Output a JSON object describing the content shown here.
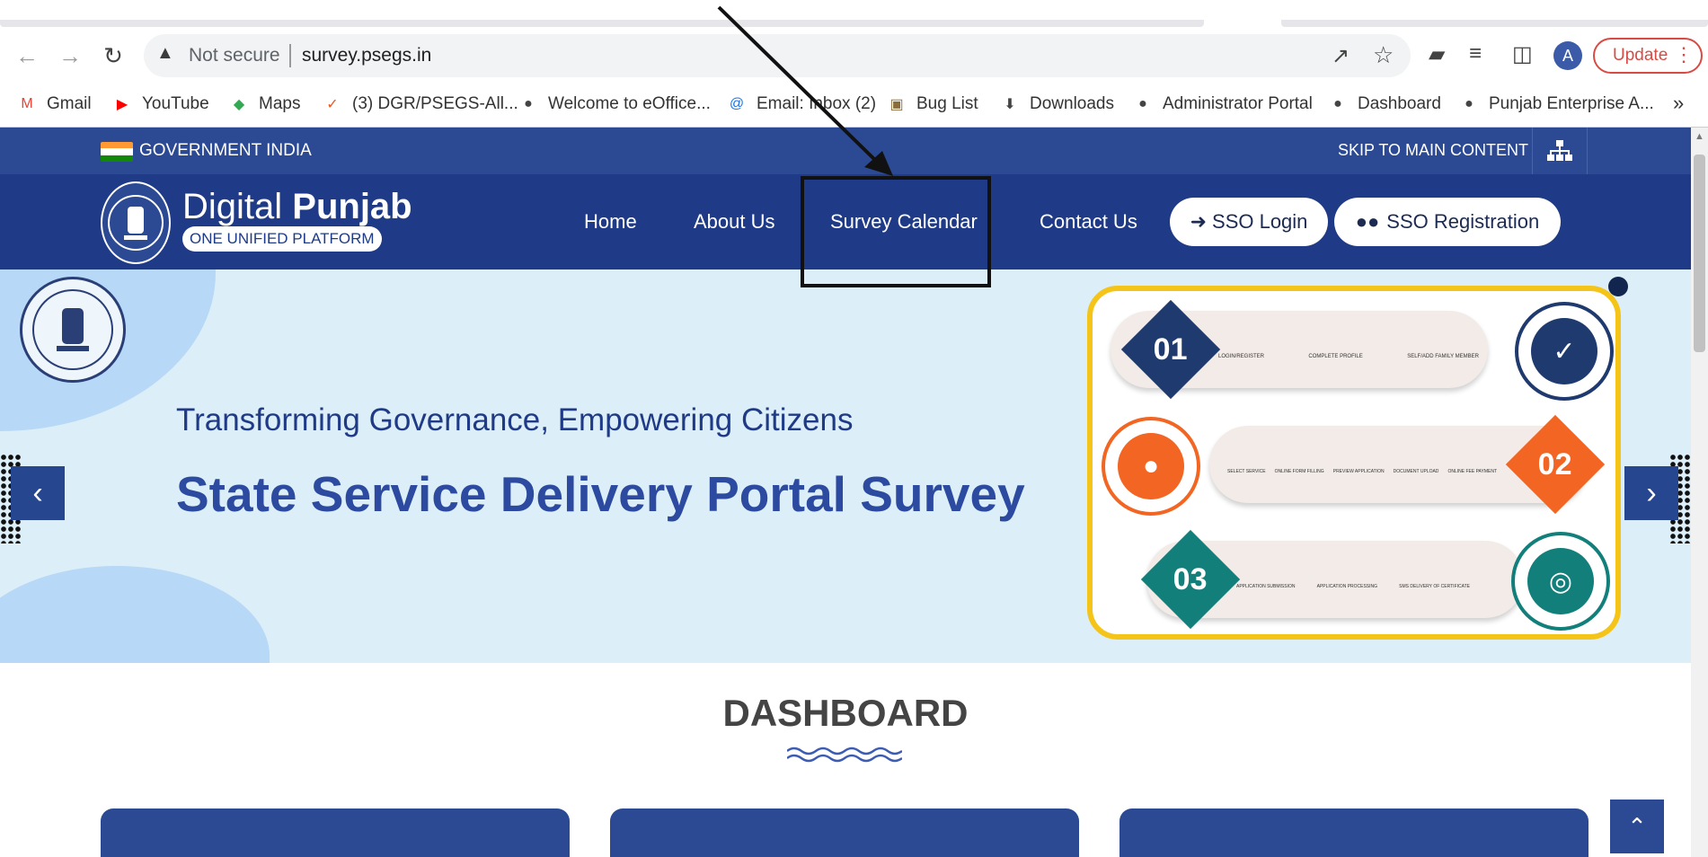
{
  "browser": {
    "address": {
      "warning": "Not secure",
      "url": "survey.psegs.in"
    },
    "avatar_letter": "A",
    "update_label": "Update",
    "bookmarks": [
      {
        "label": "Gmail",
        "icon": "gmail-icon",
        "color": "#ea4335"
      },
      {
        "label": "YouTube",
        "icon": "youtube-icon",
        "color": "#ff0000"
      },
      {
        "label": "Maps",
        "icon": "maps-icon",
        "color": "#34a853"
      },
      {
        "label": "(3) DGR/PSEGS-All...",
        "icon": "check-icon",
        "color": "#e25b2a"
      },
      {
        "label": "Welcome to eOffice...",
        "icon": "globe-icon",
        "color": "#444444"
      },
      {
        "label": "Email: Inbox (2)",
        "icon": "at-icon",
        "color": "#1a73e8"
      },
      {
        "label": "Bug List",
        "icon": "bug-icon",
        "color": "#8a6d3b"
      },
      {
        "label": "Downloads",
        "icon": "download-icon",
        "color": "#444444"
      },
      {
        "label": "Administrator Portal",
        "icon": "globe-icon",
        "color": "#444444"
      },
      {
        "label": "Dashboard",
        "icon": "globe-icon",
        "color": "#444444"
      },
      {
        "label": "Punjab Enterprise A...",
        "icon": "globe-icon",
        "color": "#444444"
      }
    ],
    "more_label": "»"
  },
  "govbar": {
    "label": "GOVERNMENT INDIA",
    "skip": "SKIP TO MAIN CONTENT"
  },
  "brand": {
    "title_light": "Digital ",
    "title_bold": "Punjab",
    "subtitle": "ONE UNIFIED PLATFORM"
  },
  "nav": {
    "links": [
      "Home",
      "About Us",
      "Survey Calendar",
      "Contact Us"
    ],
    "sso_login": "SSO Login",
    "sso_registration": "SSO Registration"
  },
  "hero": {
    "subtitle": "Transforming Governance, Empowering Citizens",
    "title": "State Service Delivery Portal Survey",
    "steps": [
      {
        "num": "01",
        "color": "#1f3a6e",
        "ring": "#1f3a6e",
        "captions": [
          "LOGIN/REGISTER",
          "COMPLETE PROFILE",
          "SELF/ADD FAMILY MEMBER"
        ]
      },
      {
        "num": "02",
        "color": "#f26522",
        "ring": "#f26522",
        "captions": [
          "SELECT SERVICE",
          "ONLINE FORM FILLING",
          "PREVIEW APPLICATION",
          "DOCUMENT UPLOAD",
          "ONLINE FEE PAYMENT"
        ]
      },
      {
        "num": "03",
        "color": "#137f7b",
        "ring": "#137f7b",
        "captions": [
          "APPLICATION SUBMISSION",
          "APPLICATION PROCESSING",
          "SMS DELIVERY OF CERTIFICATE"
        ]
      }
    ]
  },
  "dashboard": {
    "title": "DASHBOARD"
  },
  "colors": {
    "primary": "#2c4a93",
    "nav": "#1f3a86",
    "hero_bg": "#dceef8",
    "accent_yellow": "#f4c419"
  }
}
